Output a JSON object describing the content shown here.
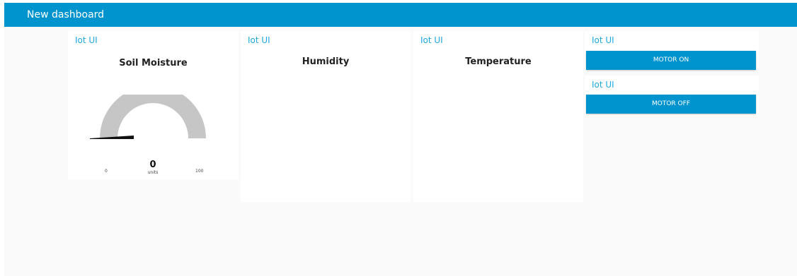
{
  "toolbar": {
    "title": "New dashboard"
  },
  "groups": [
    {
      "title": "Iot UI",
      "widget": {
        "title": "Soil Moisture",
        "type": "gauge",
        "value": "0",
        "units": "units",
        "min": "0",
        "max": "100",
        "level": 0
      }
    },
    {
      "title": "Iot UI",
      "widget": {
        "title": "Humidity"
      }
    },
    {
      "title": "Iot UI",
      "widget": {
        "title": "Temperature"
      }
    },
    {
      "title": "Iot UI",
      "button_label": "MOTOR ON"
    },
    {
      "title": "Iot UI",
      "button_label": "MOTOR OFF"
    }
  ],
  "colors": {
    "toolbar": "#0094ce",
    "group_title": "#1fa8e0",
    "button": "#0094ce",
    "gauge_track": "#c6c6c6"
  }
}
